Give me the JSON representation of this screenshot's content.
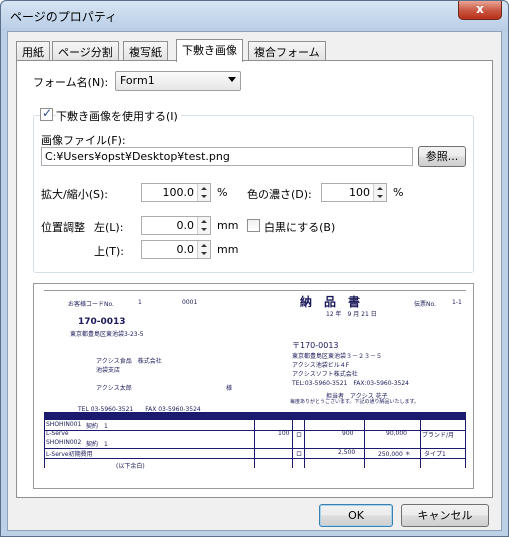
{
  "window": {
    "title": "ページのプロパティ",
    "close_glyph": "x"
  },
  "tabs": [
    {
      "label": "用紙"
    },
    {
      "label": "ページ分割"
    },
    {
      "label": "複写紙"
    },
    {
      "label": "下敷き画像"
    },
    {
      "label": "複合フォーム"
    }
  ],
  "form": {
    "label": "フォーム名(N):",
    "value": "Form1"
  },
  "use_image": {
    "label": "下敷き画像を使用する(I)",
    "checked": true
  },
  "image_file": {
    "label": "画像ファイル(F):",
    "value": "C:¥Users¥opst¥Desktop¥test.png",
    "browse": "参照..."
  },
  "scale": {
    "label": "拡大/縮小(S):",
    "value": "100.0",
    "unit": "%"
  },
  "density": {
    "label": "色の濃さ(D):",
    "value": "100",
    "unit": "%"
  },
  "position": {
    "label": "位置調整",
    "left_label": "左(L):",
    "left_value": "0.0",
    "left_unit": "mm",
    "top_label": "上(T):",
    "top_value": "0.0",
    "top_unit": "mm"
  },
  "monochrome": {
    "label": "白黒にする(B)",
    "checked": false
  },
  "preview": {
    "customer_code_label": "お客様コードNo.",
    "customer_code_1": "1",
    "customer_code_2": "0001",
    "doc_title": "納　品　書",
    "doc_no_label": "伝票No.",
    "doc_no": "1-1",
    "date": "12 年　9 月 21 日",
    "zip1": "170-0013",
    "addr1": "東京都豊島区東池袋3-23-5",
    "company1": "アクシス食品　株式会社",
    "branch1": "池袋支店",
    "person1": "アクシス太郎",
    "honorific": "様",
    "zip2": "〒170-0013",
    "addr2": "東京都豊島区東池袋３－２３－５",
    "bldg2": "アクシス池袋ビル４F",
    "company2": "アクシスソフト株式会社",
    "tel2": "TEL:03-5960-3521　FAX:03-5960-3524",
    "charge": "担当者　アクシス 花子",
    "note": "毎度ありがとうございます。下記の通り納品いたします。",
    "tel1": "TEL 03-5960-3521　　FAX 03-5960-3524",
    "row1_code": "SHOHIN001",
    "row1_kind": "契約　1",
    "row1_name": "L-Serve",
    "row1_qty": "100",
    "row1_unit": "ロ",
    "row1_price": "900",
    "row1_amount": "90,000",
    "row1_note": "ブランド/月",
    "row2_code": "SHOHIN002",
    "row2_kind": "契約　1",
    "row2_name": "L-Serve初期費用",
    "row2_unit": "ロ",
    "row2_price": "2,500",
    "row2_amount": "250,000 ＊",
    "row2_note": "タイプ1",
    "row3": "(以下余白)"
  },
  "buttons": {
    "ok": "OK",
    "cancel": "キャンセル"
  }
}
